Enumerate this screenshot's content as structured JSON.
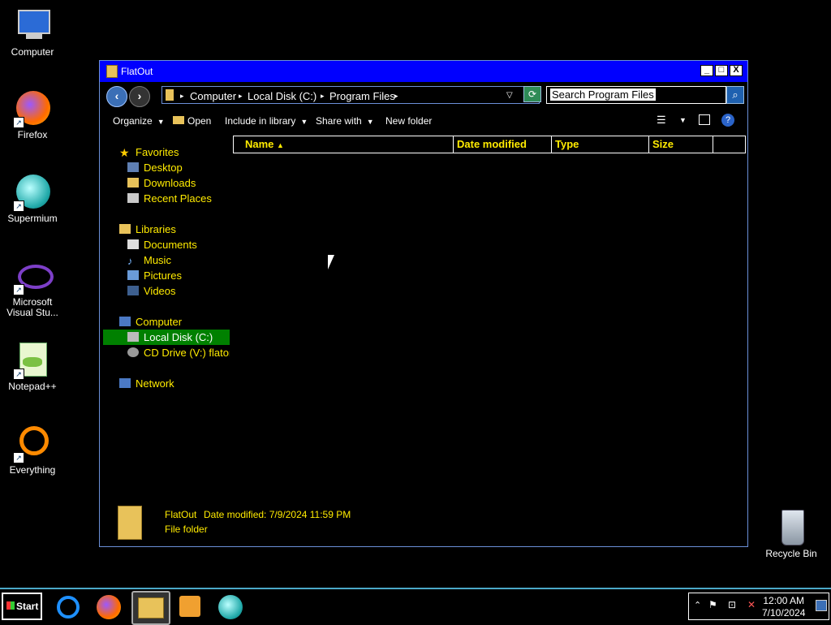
{
  "desktop": {
    "icons": [
      {
        "label": "Computer"
      },
      {
        "label": "Firefox"
      },
      {
        "label": "Supermium"
      },
      {
        "label": "Microsoft Visual Stu..."
      },
      {
        "label": "Notepad++"
      },
      {
        "label": "Everything"
      },
      {
        "label": "Recycle Bin"
      }
    ]
  },
  "window": {
    "title": "FlatOut",
    "controls": {
      "minimize": "_",
      "maximize": "□",
      "close": "X"
    },
    "nav": {
      "back": "‹",
      "forward": "›",
      "breadcrumbs": [
        "Computer",
        "Local Disk (C:)",
        "Program Files"
      ],
      "search_value": "Search Program Files"
    },
    "toolbar": {
      "organize": "Organize",
      "open": "Open",
      "include_in_library": "Include in library",
      "share_with": "Share with",
      "new_folder": "New folder"
    },
    "sidebar": {
      "favorites": "Favorites",
      "favorites_items": [
        "Desktop",
        "Downloads",
        "Recent Places"
      ],
      "libraries": "Libraries",
      "libraries_items": [
        "Documents",
        "Music",
        "Pictures",
        "Videos"
      ],
      "computer": "Computer",
      "computer_items": [
        "Local Disk (C:)",
        "CD Drive (V:) flator"
      ],
      "network": "Network"
    },
    "columns": {
      "name": "Name",
      "date_modified": "Date modified",
      "type": "Type",
      "size": "Size"
    },
    "details": {
      "name": "FlatOut",
      "date_modified": "Date modified: 7/9/2024 11:59 PM",
      "type": "File folder"
    }
  },
  "taskbar": {
    "start": "Start",
    "clock_time": "12:00 AM",
    "clock_date": "7/10/2024"
  }
}
